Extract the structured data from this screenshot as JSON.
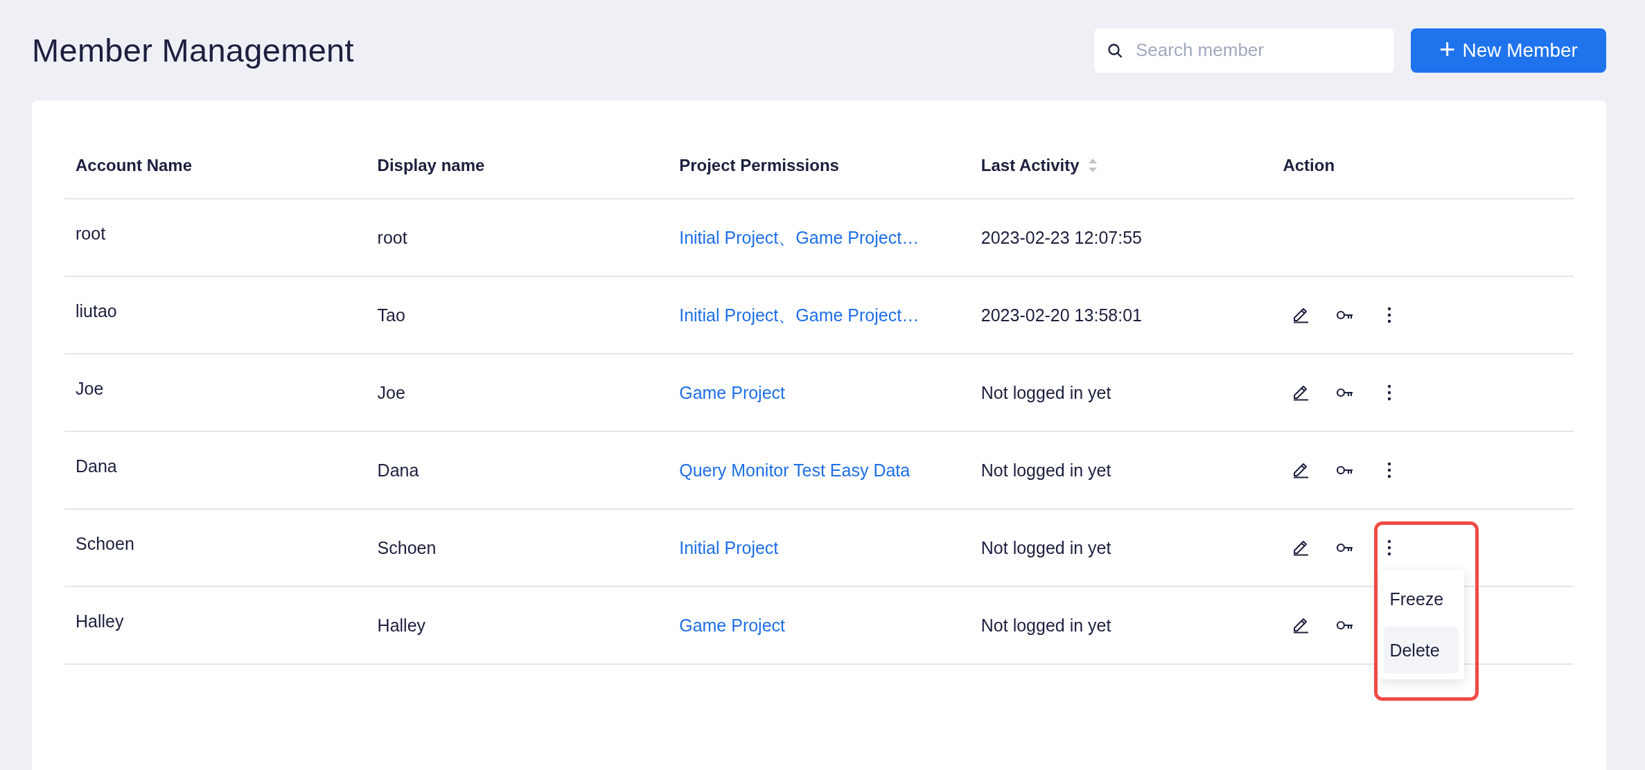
{
  "page": {
    "title": "Member Management"
  },
  "search": {
    "placeholder": "Search member"
  },
  "new_button": {
    "icon": "+",
    "label": "New Member"
  },
  "table": {
    "columns": [
      {
        "label": "Account Name",
        "sortable": false
      },
      {
        "label": "Display name",
        "sortable": false
      },
      {
        "label": "Project Permissions",
        "sortable": false
      },
      {
        "label": "Last Activity",
        "sortable": true
      },
      {
        "label": "Action",
        "sortable": false
      }
    ],
    "rows": [
      {
        "account": "root",
        "display": "root",
        "projects": "Initial Project、Game Project…",
        "last_activity": "2023-02-23 12:07:55",
        "actions": false
      },
      {
        "account": "liutao",
        "display": "Tao",
        "projects": "Initial Project、Game Project…",
        "last_activity": "2023-02-20 13:58:01",
        "actions": true,
        "menu_open": false
      },
      {
        "account": "Joe",
        "display": "Joe",
        "projects": "Game Project",
        "last_activity": "Not logged in yet",
        "actions": true,
        "menu_open": false
      },
      {
        "account": "Dana",
        "display": "Dana",
        "projects": "Query Monitor Test Easy Data",
        "last_activity": "Not logged in yet",
        "actions": true,
        "menu_open": false
      },
      {
        "account": "Schoen",
        "display": "Schoen",
        "projects": "Initial Project",
        "last_activity": "Not logged in yet",
        "actions": true,
        "menu_open": true,
        "menu": [
          {
            "label": "Freeze",
            "highlighted": false
          },
          {
            "label": "Delete",
            "highlighted": true
          }
        ]
      },
      {
        "account": "Halley",
        "display": "Halley",
        "projects": "Game Project",
        "last_activity": "Not logged in yet",
        "actions": true,
        "menu_open": false
      }
    ]
  }
}
